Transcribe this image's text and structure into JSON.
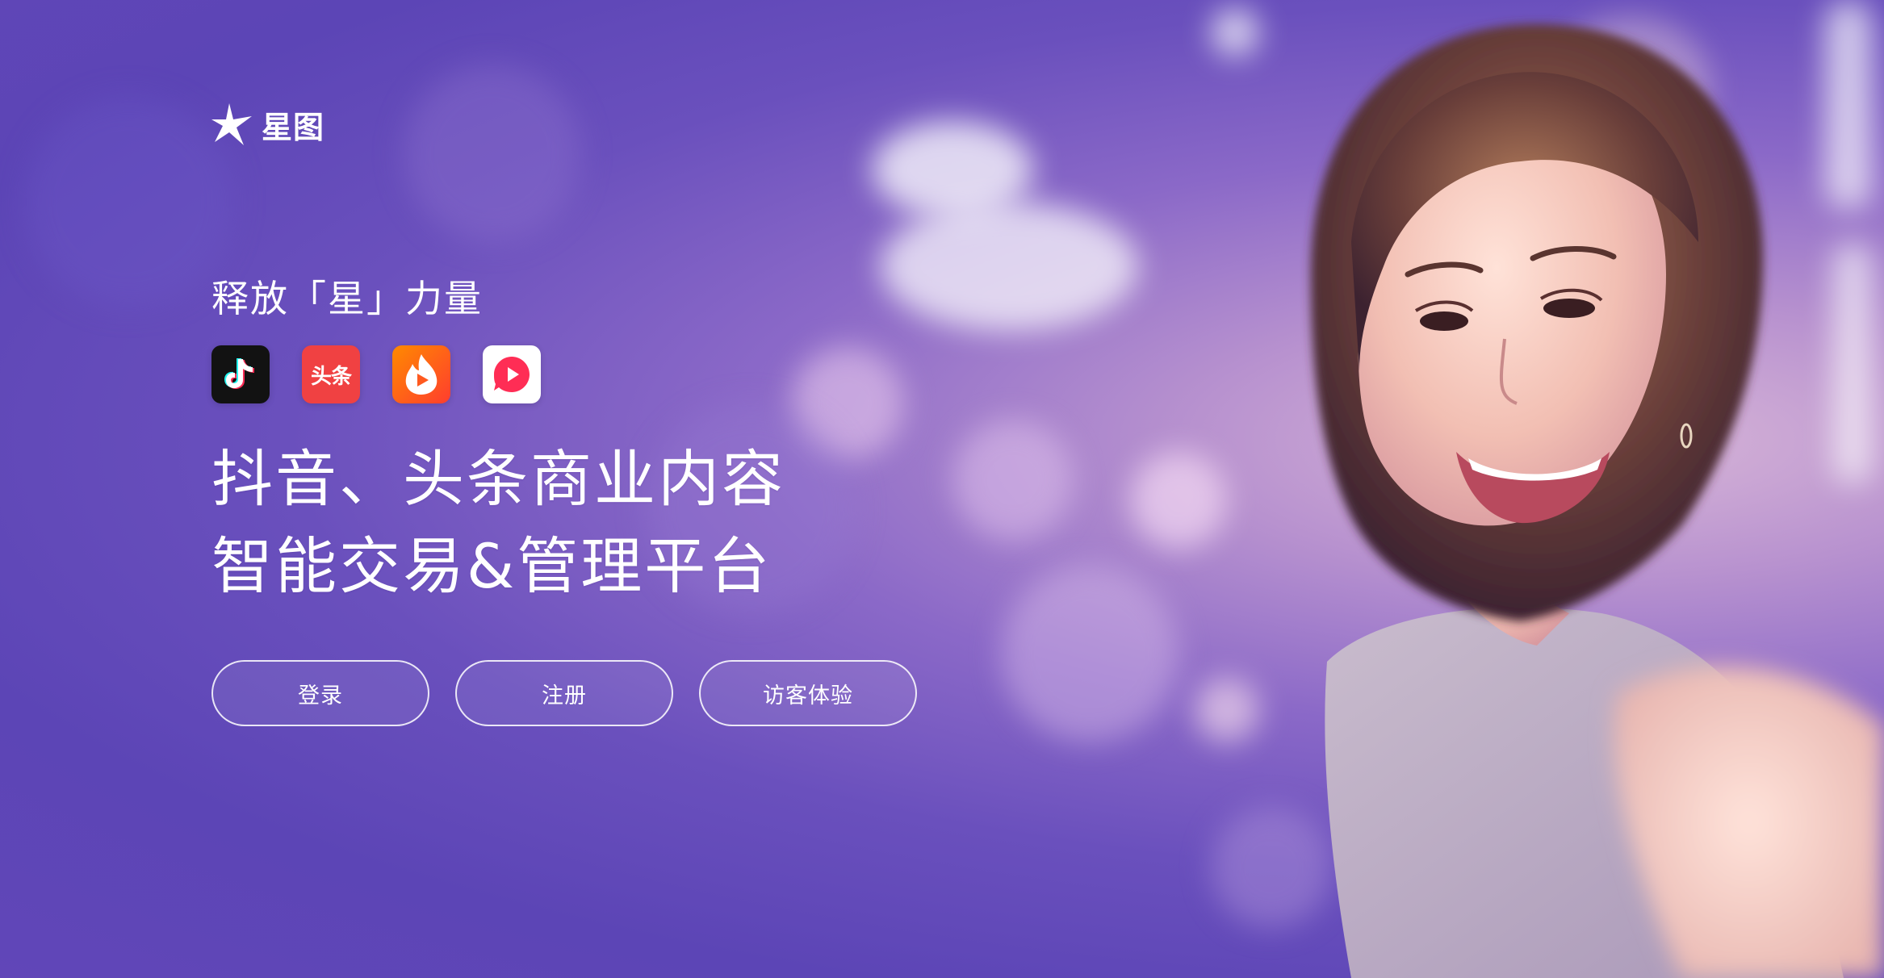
{
  "brand": {
    "name": "星图",
    "logo_icon": "star-logo-icon"
  },
  "hero": {
    "tagline": "释放「星」力量",
    "headline_line1": "抖音、头条商业内容",
    "headline_line2": "智能交易&管理平台"
  },
  "apps": [
    {
      "icon": "douyin-app-icon"
    },
    {
      "icon": "toutiao-app-icon",
      "label": "头条"
    },
    {
      "icon": "huoshan-app-icon"
    },
    {
      "icon": "xigua-app-icon"
    }
  ],
  "actions": {
    "login_label": "登录",
    "register_label": "注册",
    "guest_label": "访客体验"
  },
  "colors": {
    "background_purple": "#6a50bd",
    "douyin": "#121212",
    "toutiao": "#f04142",
    "huoshan": "#ff5a1f",
    "xigua": "#ff2d55"
  }
}
